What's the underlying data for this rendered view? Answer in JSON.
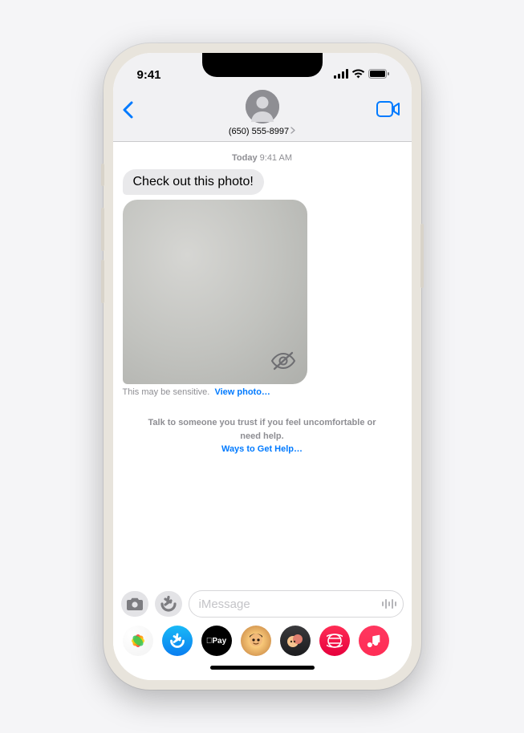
{
  "status": {
    "time": "9:41"
  },
  "header": {
    "contact": "(650) 555-8997"
  },
  "conversation": {
    "timestamp_day": "Today",
    "timestamp_time": "9:41 AM",
    "message_text": "Check out this photo!",
    "sensitive_label": "This may be sensitive.",
    "view_photo_label": "View photo…",
    "help_text": "Talk to someone you trust if you feel uncomfortable or need help.",
    "help_link": "Ways to Get Help…"
  },
  "compose": {
    "placeholder": "iMessage"
  },
  "apps": {
    "pay_label": "Pay"
  }
}
